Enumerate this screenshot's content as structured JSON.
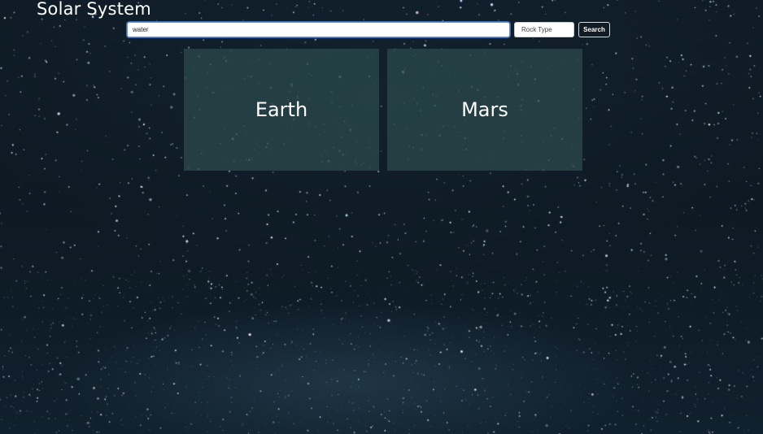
{
  "header": {
    "title": "Solar System"
  },
  "search": {
    "query": "water",
    "rock_type_label": "Rock Type",
    "button_label": "Search"
  },
  "results": [
    {
      "name": "Earth"
    },
    {
      "name": "Mars"
    }
  ],
  "colors": {
    "background": "#0f1c27",
    "card": "#2a484a",
    "button": "#121c24",
    "input_focus": "#3d6fb4"
  }
}
